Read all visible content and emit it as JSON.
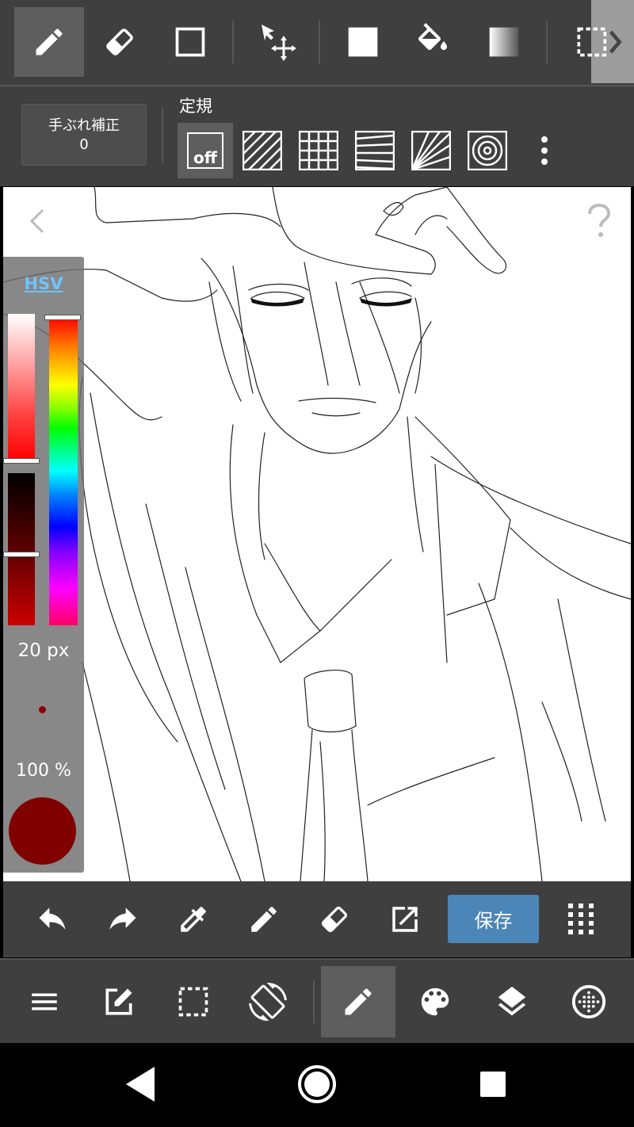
{
  "top_toolbar": {
    "tools": [
      "pencil-icon",
      "eraser-icon",
      "rectangle-icon",
      "move-select-icon",
      "fill-rect-icon",
      "bucket-icon",
      "gradient-icon",
      "select-more-icon"
    ]
  },
  "stabilizer": {
    "label": "手ぶれ補正",
    "value": "0"
  },
  "ruler": {
    "title": "定規",
    "off_label": "off",
    "options": [
      "ruler-off",
      "ruler-parallel",
      "ruler-grid",
      "ruler-perspective",
      "ruler-radial",
      "ruler-concentric",
      "more"
    ]
  },
  "color_panel": {
    "mode": "HSV",
    "brush_size": "20 px",
    "opacity": "100 %",
    "current_color": "#800000"
  },
  "action_bar": {
    "save_label": "保存",
    "actions": [
      "undo-icon",
      "redo-icon",
      "eyedropper-icon",
      "pen-icon",
      "eraser-icon",
      "export-icon",
      "save-button",
      "grid-menu-icon"
    ]
  },
  "main_toolbar": {
    "items": [
      "menu-icon",
      "edit-icon",
      "selection-icon",
      "rotate-icon",
      "brush-icon",
      "palette-icon",
      "layers-icon",
      "material-icon"
    ]
  },
  "nav_bar": {
    "items": [
      "back-icon",
      "home-icon",
      "recents-icon"
    ]
  }
}
